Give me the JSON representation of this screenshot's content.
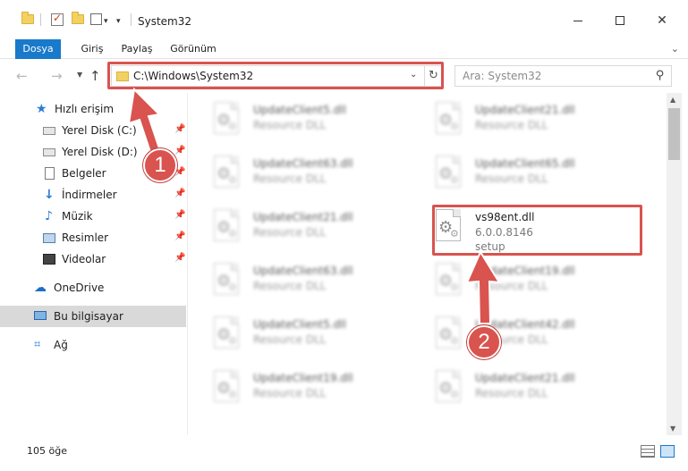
{
  "window": {
    "title": "System32",
    "quick_access": [
      "folder-icon",
      "properties-check-icon",
      "new-folder-icon",
      "customize-icon"
    ]
  },
  "ribbon": {
    "tabs": [
      "Dosya",
      "Giriş",
      "Paylaş",
      "Görünüm"
    ]
  },
  "navigation": {
    "address": "C:\\Windows\\System32",
    "search_placeholder": "Ara: System32"
  },
  "sidebar": {
    "items": [
      {
        "label": "Hızlı erişim",
        "icon": "star-icon",
        "pinned": false
      },
      {
        "label": "Yerel Disk (C:)",
        "icon": "drive-icon",
        "pinned": true
      },
      {
        "label": "Yerel Disk (D:)",
        "icon": "drive-icon",
        "pinned": true
      },
      {
        "label": "Belgeler",
        "icon": "documents-icon",
        "pinned": true
      },
      {
        "label": "İndirmeler",
        "icon": "download-icon",
        "pinned": true
      },
      {
        "label": "Müzik",
        "icon": "music-icon",
        "pinned": true
      },
      {
        "label": "Resimler",
        "icon": "pictures-icon",
        "pinned": true
      },
      {
        "label": "Videolar",
        "icon": "videos-icon",
        "pinned": true
      },
      {
        "label": "OneDrive",
        "icon": "cloud-icon",
        "pinned": false
      },
      {
        "label": "Bu bilgisayar",
        "icon": "computer-icon",
        "pinned": false,
        "selected": true
      },
      {
        "label": "Ağ",
        "icon": "network-icon",
        "pinned": false
      }
    ]
  },
  "files": {
    "left": [
      {
        "name": "UpdateClient5.dll",
        "desc": "Resource DLL"
      },
      {
        "name": "UpdateClient63.dll",
        "desc": "Resource DLL"
      },
      {
        "name": "UpdateClient21.dll",
        "desc": "Resource DLL"
      },
      {
        "name": "UpdateClient63.dll",
        "desc": "Resource DLL"
      },
      {
        "name": "UpdateClient5.dll",
        "desc": "Resource DLL"
      },
      {
        "name": "UpdateClient19.dll",
        "desc": "Resource DLL"
      }
    ],
    "right": [
      {
        "name": "UpdateClient21.dll",
        "desc": "Resource DLL"
      },
      {
        "name": "UpdateClient65.dll",
        "desc": "Resource DLL"
      },
      {
        "name": "vs98ent.dll",
        "desc": "6.0.0.8146",
        "desc2": "setup",
        "highlighted": true
      },
      {
        "name": "UpdateClient19.dll",
        "desc": "Resource DLL"
      },
      {
        "name": "UpdateClient42.dll",
        "desc": "Resource DLL"
      },
      {
        "name": "UpdateClient21.dll",
        "desc": "Resource DLL"
      }
    ]
  },
  "status": {
    "count": "105 öğe"
  },
  "annotations": {
    "step1": "1",
    "step2": "2",
    "color": "#d9534f"
  }
}
